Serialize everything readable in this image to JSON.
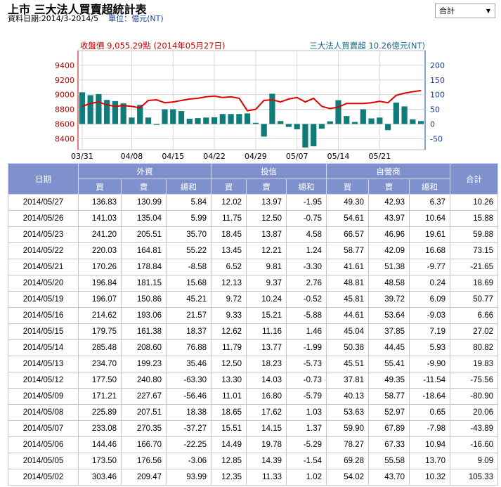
{
  "header": {
    "title": "上市 三大法人買賣超統計表",
    "period": "資料日期:2014/3-2014/5",
    "unit": "單位：億元(NT)"
  },
  "market_select": {
    "value": "合計"
  },
  "colors": {
    "price_line": "#e00000",
    "bar": "#0f7c7a",
    "header_bg": "#7f91cc",
    "axis_left": "#c00000",
    "axis_right": "#1a3f9a"
  },
  "chart_data": {
    "type": "bar",
    "price_label": "收盤價 9,055.29點 (2014年05月27日)",
    "net_label": "三大法人買賣超 10.26億元(NT)",
    "y_left_ticks": [
      8400,
      8600,
      8800,
      9000,
      9200,
      9400
    ],
    "y_left_range": [
      8250,
      9600
    ],
    "y_right_ticks": [
      -50,
      0,
      50,
      100,
      150,
      200
    ],
    "y_right_range": [
      -87.5,
      250
    ],
    "x_ticks": [
      {
        "label": "03/31",
        "index": 0
      },
      {
        "label": "04/08",
        "index": 6
      },
      {
        "label": "04/15",
        "index": 11
      },
      {
        "label": "04/22",
        "index": 16
      },
      {
        "label": "04/29",
        "index": 21
      },
      {
        "label": "05/07",
        "index": 26
      },
      {
        "label": "05/14",
        "index": 31
      },
      {
        "label": "05/21",
        "index": 36
      }
    ],
    "series": [
      {
        "name": "三大法人買賣超",
        "type": "bar",
        "values": [
          108,
          98,
          102,
          82,
          78,
          70,
          22,
          65,
          22,
          -3,
          50,
          50,
          44,
          18,
          20,
          22,
          23,
          34,
          34,
          34,
          36,
          4,
          -43,
          103,
          10,
          -10,
          -18,
          -80,
          -76,
          -16,
          9,
          81,
          27,
          7,
          50,
          19,
          22,
          -21,
          73,
          60,
          16,
          10
        ],
        "bar_labels_note": ""
      },
      {
        "name": "收盤價",
        "type": "line",
        "values": [
          8840,
          8880,
          8900,
          8860,
          8840,
          8850,
          8840,
          8820,
          8920,
          8930,
          8890,
          8900,
          8920,
          8940,
          8950,
          8970,
          8980,
          8960,
          8970,
          8950,
          8780,
          8800,
          8920,
          8930,
          8900,
          8940,
          8960,
          8900,
          8950,
          8840,
          8810,
          8830,
          8880,
          8880,
          8880,
          8890,
          8910,
          8890,
          8990,
          9020,
          9040,
          9055
        ]
      }
    ]
  },
  "table": {
    "headers": {
      "date": "日期",
      "foreign": "外資",
      "trust": "投信",
      "dealer": "自營商",
      "total": "合計",
      "buy": "買",
      "sell": "賣",
      "net": "總和"
    },
    "rows": [
      [
        "2014/05/27",
        "136.83",
        "130.99",
        "5.84",
        "12.02",
        "13.97",
        "-1.95",
        "49.30",
        "42.93",
        "6.37",
        "10.26"
      ],
      [
        "2014/05/26",
        "141.03",
        "135.04",
        "5.99",
        "11.75",
        "12.50",
        "-0.75",
        "54.61",
        "43.97",
        "10.64",
        "15.88"
      ],
      [
        "2014/05/23",
        "241.20",
        "205.51",
        "35.70",
        "18.45",
        "13.87",
        "4.58",
        "66.57",
        "46.96",
        "19.61",
        "59.88"
      ],
      [
        "2014/05/22",
        "220.03",
        "164.81",
        "55.22",
        "13.45",
        "12.21",
        "1.24",
        "58.77",
        "42.09",
        "16.68",
        "73.15"
      ],
      [
        "2014/05/21",
        "170.26",
        "178.84",
        "-8.58",
        "6.52",
        "9.81",
        "-3.30",
        "41.61",
        "51.38",
        "-9.77",
        "-21.65"
      ],
      [
        "2014/05/20",
        "196.84",
        "181.15",
        "15.68",
        "12.13",
        "9.37",
        "2.76",
        "48.81",
        "48.58",
        "0.24",
        "18.69"
      ],
      [
        "2014/05/19",
        "196.07",
        "150.86",
        "45.21",
        "9.72",
        "10.24",
        "-0.52",
        "45.81",
        "39.72",
        "6.09",
        "50.77"
      ],
      [
        "2014/05/16",
        "214.62",
        "193.06",
        "21.57",
        "9.33",
        "15.21",
        "-5.88",
        "44.61",
        "53.64",
        "-9.03",
        "6.66"
      ],
      [
        "2014/05/15",
        "179.75",
        "161.38",
        "18.37",
        "12.62",
        "11.16",
        "1.46",
        "45.04",
        "37.85",
        "7.19",
        "27.02"
      ],
      [
        "2014/05/14",
        "285.48",
        "208.60",
        "76.88",
        "11.79",
        "13.77",
        "-1.99",
        "50.38",
        "44.45",
        "5.93",
        "80.82"
      ],
      [
        "2014/05/13",
        "234.70",
        "199.23",
        "35.46",
        "12.50",
        "18.23",
        "-5.73",
        "45.51",
        "55.41",
        "-9.90",
        "19.83"
      ],
      [
        "2014/05/12",
        "177.50",
        "240.80",
        "-63.30",
        "13.30",
        "14.03",
        "-0.73",
        "37.81",
        "49.35",
        "-11.54",
        "-75.56"
      ],
      [
        "2014/05/09",
        "171.21",
        "227.67",
        "-56.46",
        "11.01",
        "16.80",
        "-5.79",
        "40.13",
        "58.77",
        "-18.64",
        "-80.90"
      ],
      [
        "2014/05/08",
        "225.89",
        "207.51",
        "18.38",
        "18.65",
        "17.62",
        "1.03",
        "53.63",
        "52.97",
        "0.65",
        "20.06"
      ],
      [
        "2014/05/07",
        "233.08",
        "270.35",
        "-37.27",
        "15.51",
        "14.15",
        "1.37",
        "59.90",
        "67.89",
        "-7.98",
        "-43.89"
      ],
      [
        "2014/05/06",
        "144.46",
        "166.70",
        "-22.25",
        "14.49",
        "19.78",
        "-5.29",
        "78.27",
        "67.33",
        "10.94",
        "-16.60"
      ],
      [
        "2014/05/05",
        "173.50",
        "176.56",
        "-3.06",
        "12.85",
        "14.39",
        "-1.54",
        "69.28",
        "55.58",
        "13.70",
        "9.09"
      ],
      [
        "2014/05/02",
        "303.46",
        "209.47",
        "93.99",
        "12.35",
        "11.33",
        "1.02",
        "54.02",
        "43.70",
        "10.32",
        "105.33"
      ]
    ]
  }
}
